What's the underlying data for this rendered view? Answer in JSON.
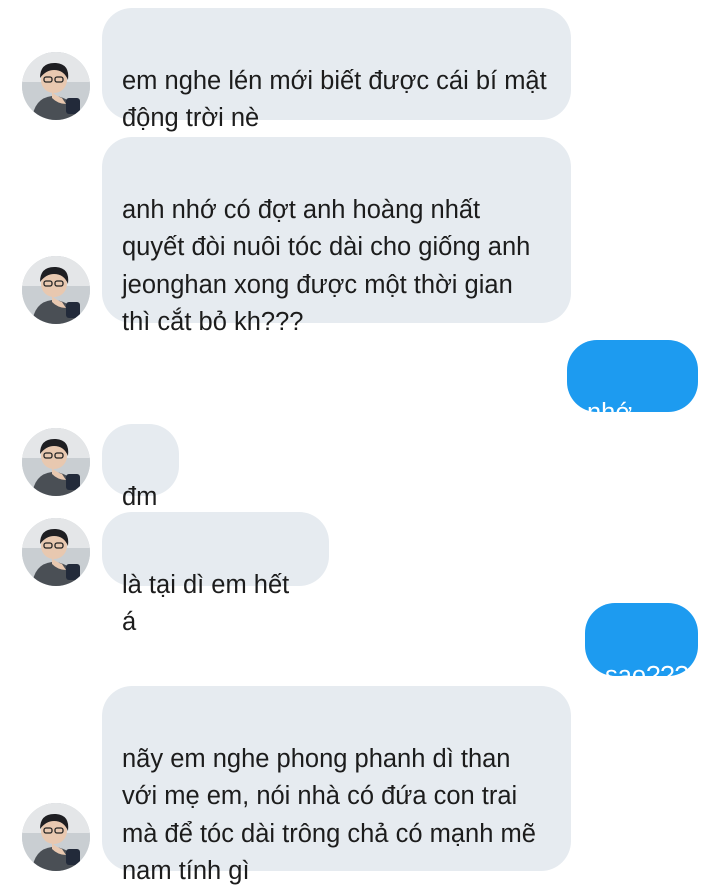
{
  "conversation": {
    "messages": [
      {
        "side": "in",
        "text": "em nghe lén mới biết được cái bí mật\nđộng trời nè",
        "emoji": "slightly-smiling-face-icon"
      },
      {
        "side": "in",
        "text": "anh nhớ có đợt anh hoàng nhất\nquyết đòi nuôi tóc dài cho giống anh\njeonghan xong được một thời gian\nthì cắt bỏ kh???"
      },
      {
        "side": "out",
        "text": "nhớ chứ"
      },
      {
        "side": "in",
        "text": "đm"
      },
      {
        "side": "in",
        "text": "là tại dì em hết á"
      },
      {
        "side": "out",
        "text": "sao???"
      },
      {
        "side": "in",
        "text": "nãy em nghe phong phanh dì than\nvới mẹ em, nói nhà có đứa con trai\nmà để tóc dài trông chả có mạnh mẽ\nnam tính gì"
      }
    ]
  },
  "colors": {
    "incoming_bubble": "#e6ebf0",
    "outgoing_bubble": "#1d9bf0",
    "text": "#1c1c1c"
  }
}
